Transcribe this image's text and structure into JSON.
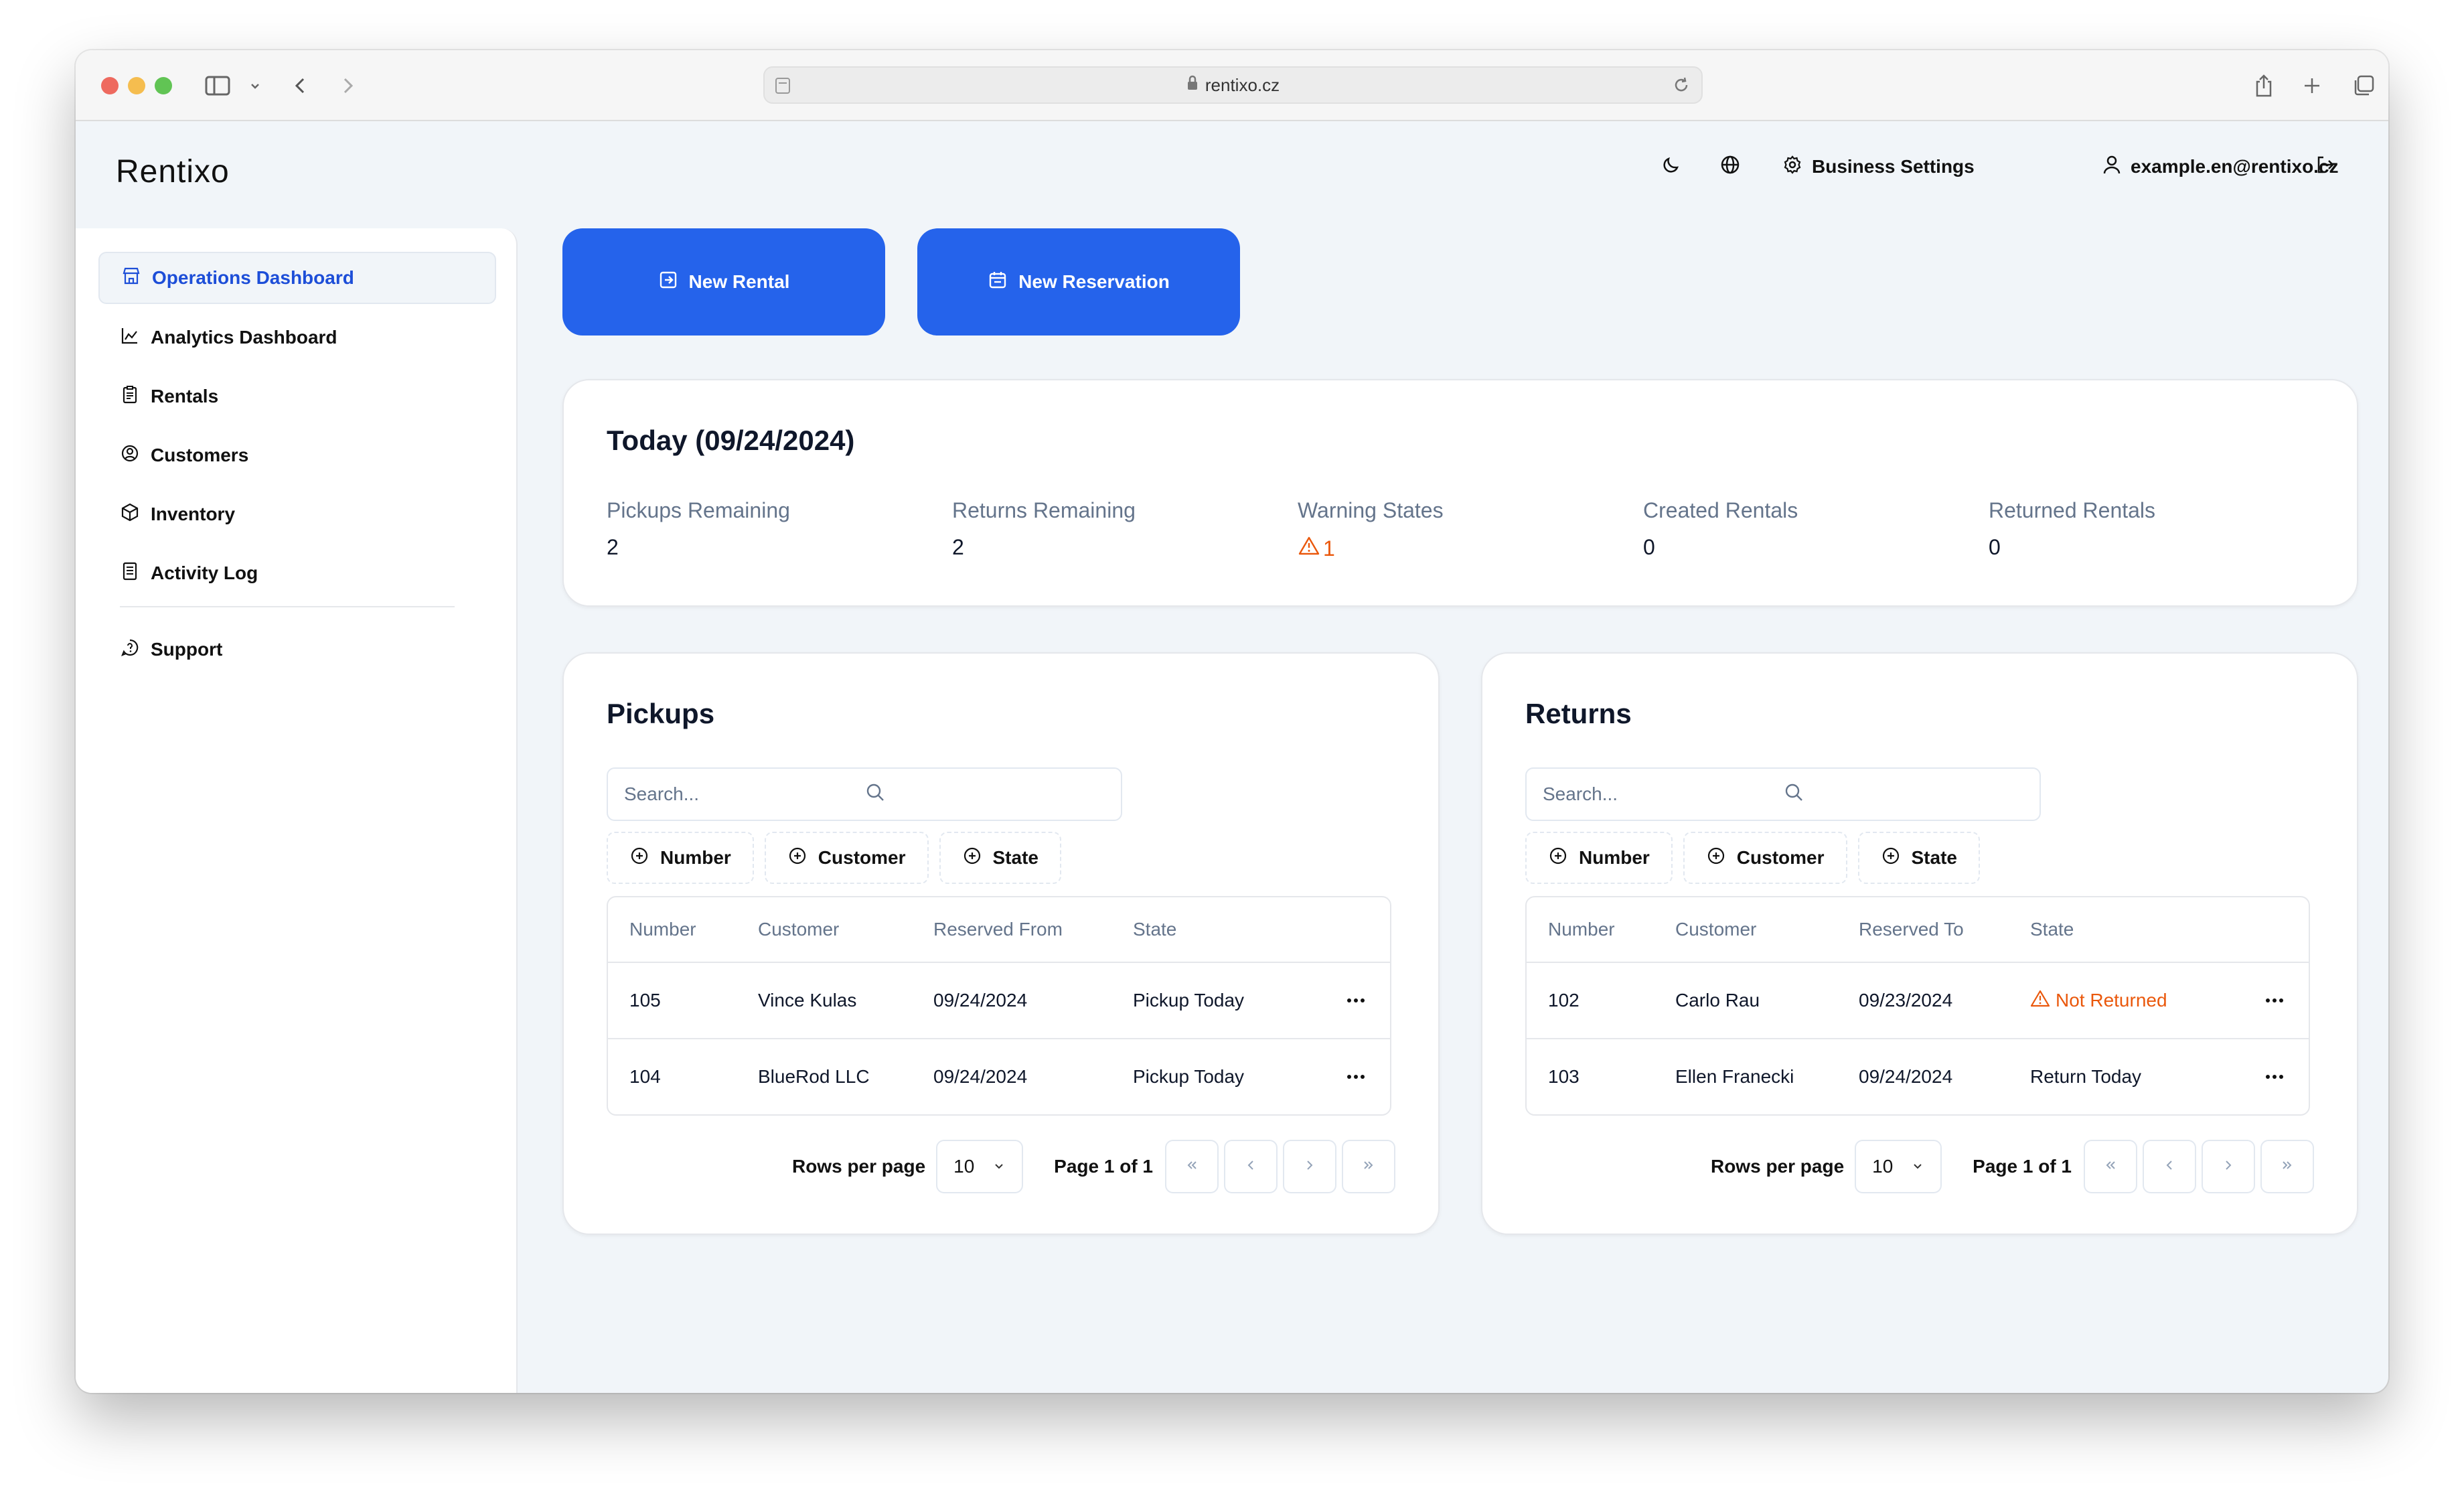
{
  "browser": {
    "url": "rentixo.cz"
  },
  "header": {
    "logo": "Rentixo",
    "business_settings": "Business Settings",
    "user_email": "example.en@rentixo.cz"
  },
  "sidebar": {
    "items": [
      {
        "label": "Operations Dashboard"
      },
      {
        "label": "Analytics Dashboard"
      },
      {
        "label": "Rentals"
      },
      {
        "label": "Customers"
      },
      {
        "label": "Inventory"
      },
      {
        "label": "Activity Log"
      },
      {
        "label": "Support"
      }
    ]
  },
  "actions": {
    "new_rental": "New Rental",
    "new_reservation": "New Reservation"
  },
  "today": {
    "title": "Today (09/24/2024)",
    "stats": [
      {
        "label": "Pickups Remaining",
        "value": "2"
      },
      {
        "label": "Returns Remaining",
        "value": "2"
      },
      {
        "label": "Warning States",
        "value": "1"
      },
      {
        "label": "Created Rentals",
        "value": "0"
      },
      {
        "label": "Returned Rentals",
        "value": "0"
      }
    ]
  },
  "pickups": {
    "title": "Pickups",
    "search_placeholder": "Search...",
    "filters": [
      "Number",
      "Customer",
      "State"
    ],
    "columns": [
      "Number",
      "Customer",
      "Reserved From",
      "State"
    ],
    "rows": [
      {
        "number": "105",
        "customer": "Vince Kulas",
        "date": "09/24/2024",
        "state": "Pickup Today"
      },
      {
        "number": "104",
        "customer": "BlueRod LLC",
        "date": "09/24/2024",
        "state": "Pickup Today"
      }
    ],
    "rows_per_page_label": "Rows per page",
    "rows_per_page": "10",
    "page_label": "Page 1 of 1"
  },
  "returns": {
    "title": "Returns",
    "search_placeholder": "Search...",
    "filters": [
      "Number",
      "Customer",
      "State"
    ],
    "columns": [
      "Number",
      "Customer",
      "Reserved To",
      "State"
    ],
    "rows": [
      {
        "number": "102",
        "customer": "Carlo Rau",
        "date": "09/23/2024",
        "state": "Not Returned"
      },
      {
        "number": "103",
        "customer": "Ellen Franecki",
        "date": "09/24/2024",
        "state": "Return Today"
      }
    ],
    "rows_per_page_label": "Rows per page",
    "rows_per_page": "10",
    "page_label": "Page 1 of 1"
  },
  "colors": {
    "primary": "#2563eb",
    "warning": "#ea580c",
    "active_nav_text": "#1d4ed8"
  }
}
